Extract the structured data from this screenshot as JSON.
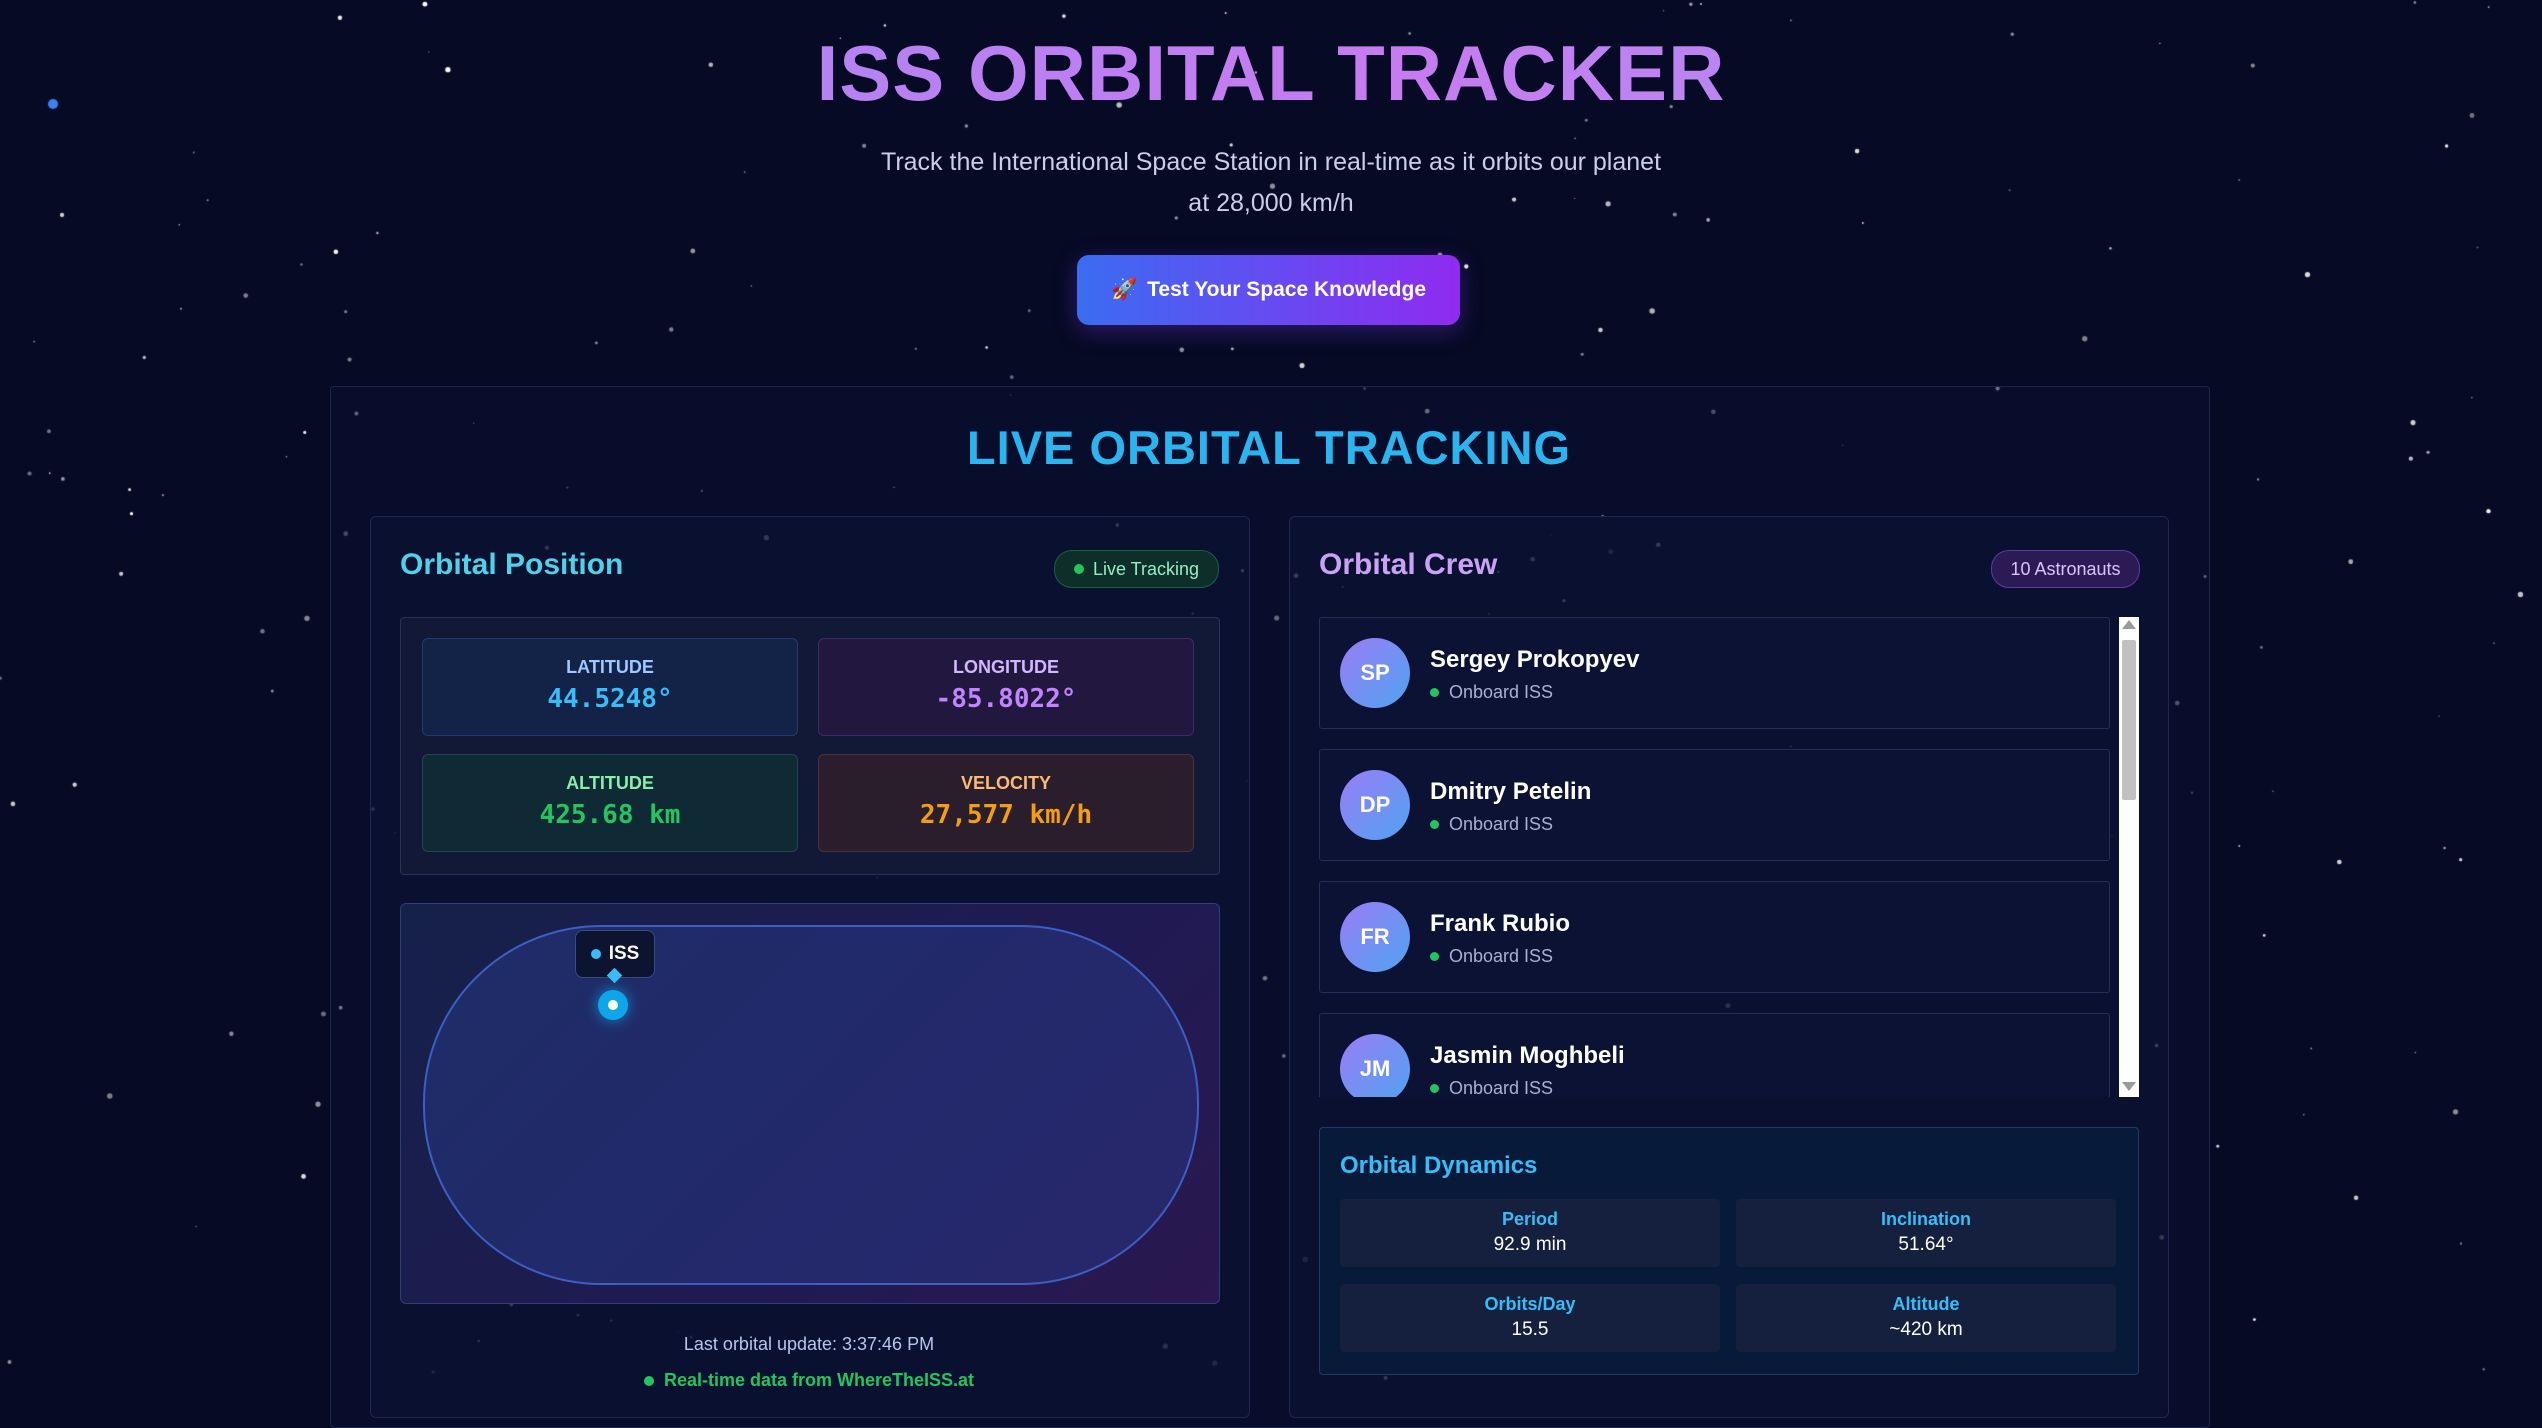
{
  "header": {
    "title": "ISS ORBITAL TRACKER",
    "subtitle_line1": "Track the International Space Station in real-time as it orbits our planet",
    "subtitle_line2": "at 28,000 km/h",
    "quiz_button": {
      "icon": "rocket-icon",
      "icon_glyph": "🚀",
      "label": "Test Your Space Knowledge"
    }
  },
  "main": {
    "section_title": "LIVE ORBITAL TRACKING",
    "position": {
      "title": "Orbital Position",
      "status_badge": "Live Tracking",
      "latitude": {
        "label": "LATITUDE",
        "value": "44.5248°"
      },
      "longitude": {
        "label": "LONGITUDE",
        "value": "-85.8022°"
      },
      "altitude": {
        "label": "ALTITUDE",
        "value": "425.68 km"
      },
      "velocity": {
        "label": "VELOCITY",
        "value": "27,577 km/h"
      },
      "map": {
        "marker_label": "ISS"
      },
      "last_update": "Last orbital update: 3:37:46 PM",
      "source": "Real-time data from WhereTheISS.at"
    },
    "crew": {
      "title": "Orbital Crew",
      "count_badge": "10 Astronauts",
      "members": [
        {
          "initials": "SP",
          "name": "Sergey Prokopyev",
          "status": "Onboard ISS"
        },
        {
          "initials": "DP",
          "name": "Dmitry Petelin",
          "status": "Onboard ISS"
        },
        {
          "initials": "FR",
          "name": "Frank Rubio",
          "status": "Onboard ISS"
        },
        {
          "initials": "JM",
          "name": "Jasmin Moghbeli",
          "status": "Onboard ISS"
        }
      ],
      "dynamics": {
        "title": "Orbital Dynamics",
        "period": {
          "label": "Period",
          "value": "92.9 min"
        },
        "inclination": {
          "label": "Inclination",
          "value": "51.64°"
        },
        "orbits_per_day": {
          "label": "Orbits/Day",
          "value": "15.5"
        },
        "altitude": {
          "label": "Altitude",
          "value": "~420 km"
        }
      }
    }
  },
  "colors": {
    "background": "#060a24",
    "accent_cyan": "#38bdf8",
    "accent_purple": "#c084fc",
    "accent_green": "#22c55e",
    "accent_orange": "#f59e0b"
  }
}
